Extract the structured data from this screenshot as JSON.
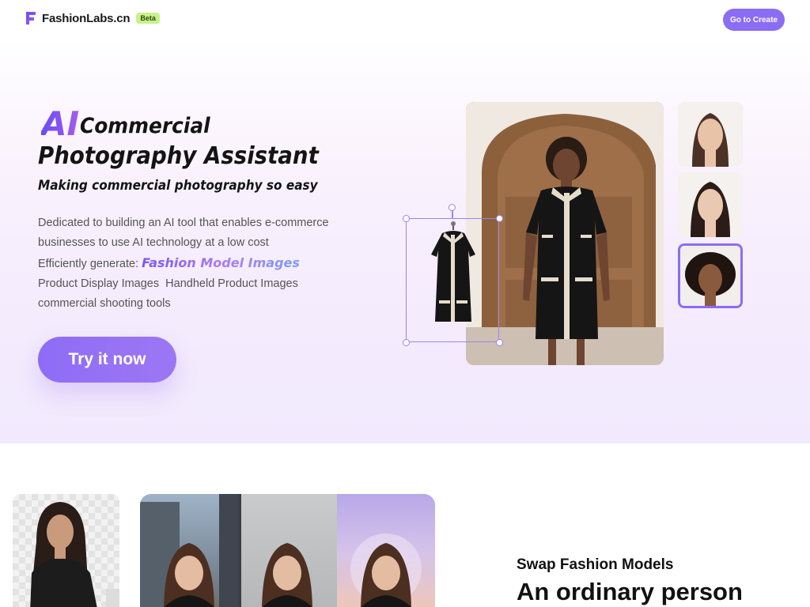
{
  "header": {
    "brand": "FashionLabs.cn",
    "badge": "Beta",
    "cta_label": "Go to Create"
  },
  "hero": {
    "ai_word": "AI",
    "title_line1": "Commercial",
    "title_line2": "Photography Assistant",
    "subtitle": "Making commercial photography so easy",
    "desc_line1": "Dedicated to building an AI tool that enables e-commerce",
    "desc_line2": "businesses to use AI technology at a low cost",
    "desc_line3_prefix": "Efficiently generate: ",
    "desc_line3_highlight": "Fashion Model Images",
    "desc_line4": "Product Display Images  Handheld Product Images",
    "desc_line5": "commercial shooting tools",
    "try_label": "Try it now"
  },
  "features": {
    "swap_title": "Swap Fashion Models",
    "swap_heading": "An ordinary person"
  },
  "colors": {
    "accent": "#8b6cf4",
    "badge_bg": "#c7f28a",
    "hero_bg": "#f5ecfd"
  },
  "icons": {
    "logo": "fashionlabs-logo-icon",
    "faces": [
      "model-face-1",
      "model-face-2",
      "model-face-3"
    ]
  }
}
